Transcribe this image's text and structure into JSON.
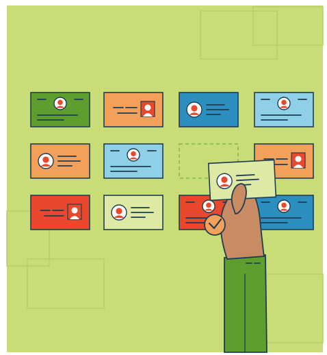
{
  "colors": {
    "background": "#c8dc78",
    "bg_lines": "#b7cd6a",
    "outline": "#1d3c52",
    "green_card": "#5e9e2e",
    "orange_card": "#f2a05a",
    "blue_card": "#2d8fbf",
    "light_blue_card": "#8fd0e8",
    "red_card": "#e8492c",
    "pale_card": "#dde9a4",
    "avatar_face": "#f5b98a",
    "avatar_body": "#e8492c",
    "skin": "#c98b63",
    "sleeve": "#5e9e2e",
    "check_badge": "#f2a05a",
    "drop_target": "#88b848"
  },
  "scene": {
    "cards": [
      {
        "name": "card-r1c1",
        "style": "centered",
        "fill": "green_card"
      },
      {
        "name": "card-r1c2",
        "style": "right-photo",
        "fill": "orange_card"
      },
      {
        "name": "card-r1c3",
        "style": "left-avatar",
        "fill": "blue_card"
      },
      {
        "name": "card-r1c4",
        "style": "centered",
        "fill": "light_blue_card"
      },
      {
        "name": "card-r2c1",
        "style": "left-avatar",
        "fill": "orange_card"
      },
      {
        "name": "card-r2c2",
        "style": "centered",
        "fill": "light_blue_card"
      },
      {
        "name": "card-r2c4",
        "style": "right-photo",
        "fill": "orange_card"
      },
      {
        "name": "card-r3c1",
        "style": "right-photo",
        "fill": "red_card"
      },
      {
        "name": "card-r3c2",
        "style": "left-avatar",
        "fill": "pale_card"
      },
      {
        "name": "card-r3c3",
        "style": "centered",
        "fill": "red_card"
      },
      {
        "name": "card-r3c4",
        "style": "centered",
        "fill": "blue_card"
      }
    ],
    "empty_slot": "card-r2c3",
    "held_card": {
      "style": "left-avatar",
      "fill": "pale_card"
    },
    "icons": [
      "person-avatar-icon",
      "check-badge-icon"
    ]
  }
}
